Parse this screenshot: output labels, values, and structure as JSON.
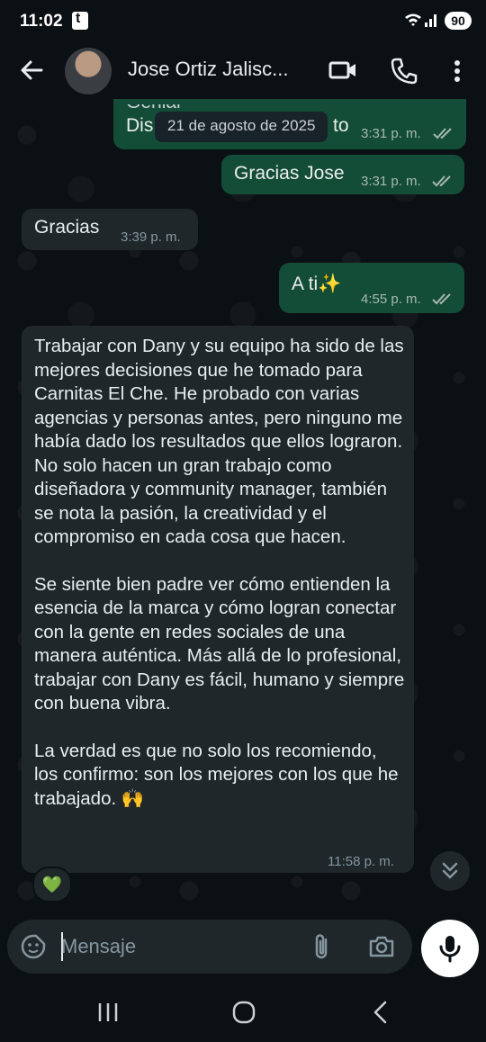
{
  "status_bar": {
    "time": "11:02",
    "battery": "90"
  },
  "header": {
    "contact_name": "Jose Ortiz Jalisc..."
  },
  "chat": {
    "date_chip": "21 de agosto de 2025",
    "messages": [
      {
        "id": "m1",
        "direction": "out",
        "text_top": "Genial",
        "text": "Dis",
        "text_end": "to",
        "time": "3:31 p. m."
      },
      {
        "id": "m2",
        "direction": "out",
        "text": "Gracias Jose",
        "time": "3:31 p. m."
      },
      {
        "id": "m3",
        "direction": "in",
        "text": "Gracias",
        "time": "3:39 p. m."
      },
      {
        "id": "m4",
        "direction": "out",
        "text": "A ti✨",
        "time": "4:55 p. m."
      },
      {
        "id": "m5",
        "direction": "in",
        "paragraphs": [
          "Trabajar con Dany y su equipo ha sido de las mejores decisiones que he tomado para Carnitas El Che. He probado con varias agencias y personas antes, pero ninguno me había dado los resultados que ellos lograron. No solo hacen un gran trabajo como diseñadora y community manager, también se nota la pasión, la creatividad y el compromiso en cada cosa que hacen.",
          "Se siente bien padre ver cómo entienden la esencia de la marca y cómo logran conectar con la gente en redes sociales de una manera auténtica. Más allá de lo profesional, trabajar con Dany es fácil, humano y siempre con buena vibra.",
          "La verdad es que no solo los recomiendo, los confirmo: son los mejores con los que he trabajado. 🙌"
        ],
        "time": "11:58 p. m.",
        "reaction": "💚"
      }
    ]
  },
  "input": {
    "placeholder": "Mensaje"
  },
  "icons": {
    "back": "arrow-left-icon",
    "video": "video-camera-icon",
    "call": "phone-icon",
    "menu": "more-vertical-icon",
    "sticker": "sticker-icon",
    "attach": "paperclip-icon",
    "camera": "camera-icon",
    "mic": "microphone-icon",
    "scroll": "double-chevron-down-icon",
    "ticks": "double-check-icon"
  },
  "colors": {
    "background": "#0b1014",
    "outgoing_bubble": "#144d37",
    "incoming_bubble": "#1f272a",
    "read_ticks": "#a7b8b0"
  }
}
